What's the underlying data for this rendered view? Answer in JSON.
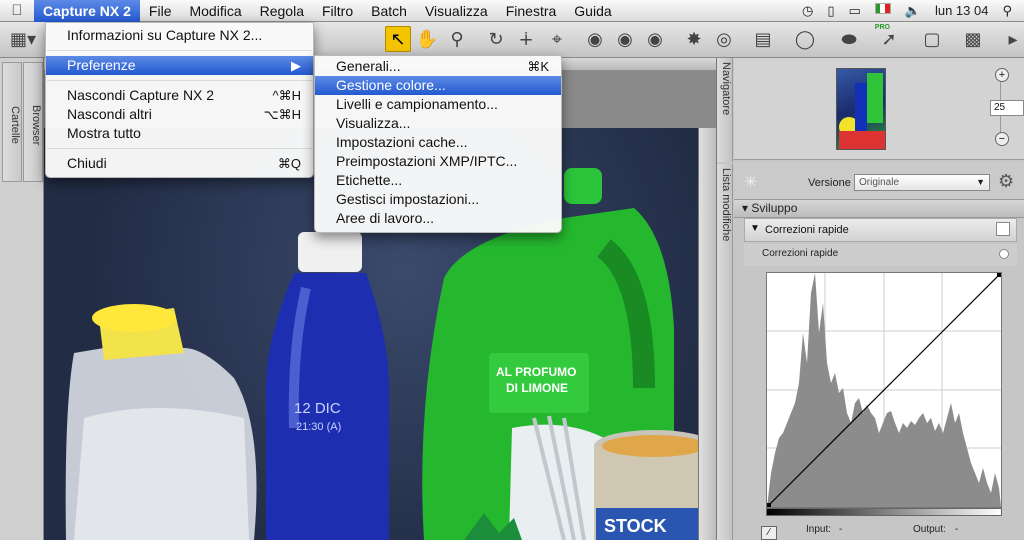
{
  "menubar": {
    "apple_icon": "apple-icon",
    "app_name": "Capture NX 2",
    "items": [
      "File",
      "Modifica",
      "Regola",
      "Filtro",
      "Batch",
      "Visualizza",
      "Finestra",
      "Guida"
    ],
    "clock": "lun 13 04",
    "pro_label": "PRO",
    "status_icons": [
      "time-machine-icon",
      "usb-icon",
      "display-icon",
      "flag-icon",
      "volume-icon",
      "spotlight-icon"
    ]
  },
  "app_menu": {
    "items": [
      {
        "label": "Informazioni su Capture NX 2...",
        "shortcut": ""
      },
      {
        "label": "Preferenze",
        "shortcut": "▶"
      },
      {
        "label": "Nascondi Capture NX 2",
        "shortcut": "^⌘H"
      },
      {
        "label": "Nascondi altri",
        "shortcut": "⌥⌘H"
      },
      {
        "label": "Mostra tutto",
        "shortcut": ""
      },
      {
        "label": "Chiudi",
        "shortcut": "⌘Q"
      }
    ]
  },
  "submenu": {
    "items": [
      {
        "label": "Generali...",
        "shortcut": "⌘K"
      },
      {
        "label": "Gestione colore...",
        "shortcut": ""
      },
      {
        "label": "Livelli e campionamento...",
        "shortcut": ""
      },
      {
        "label": "Visualizza...",
        "shortcut": ""
      },
      {
        "label": "Impostazioni cache...",
        "shortcut": ""
      },
      {
        "label": "Preimpostazioni XMP/IPTC...",
        "shortcut": ""
      },
      {
        "label": "Etichette...",
        "shortcut": ""
      },
      {
        "label": "Gestisci impostazioni...",
        "shortcut": ""
      },
      {
        "label": "Aree di lavoro...",
        "shortcut": ""
      }
    ],
    "highlighted": "Gestione colore..."
  },
  "left_panels": {
    "tabs": [
      "Cartelle",
      "Browser"
    ]
  },
  "right_panel": {
    "navigator_tab": "Navigatore",
    "edit_list_tab": "Lista modifiche",
    "zoom_value": "25",
    "zoom_unit": "%",
    "version_label": "Versione",
    "version_value": "Originale",
    "section": "Sviluppo",
    "quick_fix_header": "Correzioni rapide",
    "quick_fix_sub": "Correzioni rapide",
    "input_label": "Input:",
    "input_value": "-",
    "output_label": "Output:",
    "output_value": "-"
  },
  "photo": {
    "labels": [
      "AL PROFUMO",
      "DI LIMONE",
      "12 DIC",
      "21:30 (A)",
      "STOCK"
    ]
  },
  "colors": {
    "highlight": "#2f63d8",
    "tool_selected": "#f5c400"
  }
}
